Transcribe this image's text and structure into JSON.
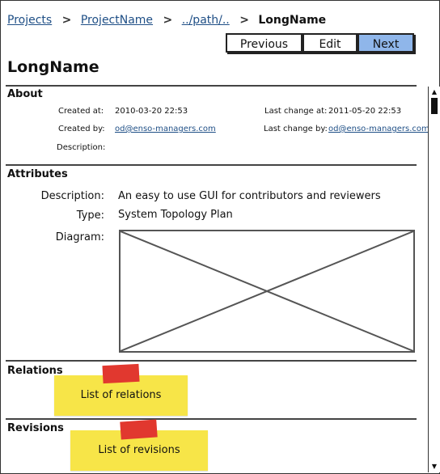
{
  "breadcrumb": {
    "items": [
      "Projects",
      "ProjectName",
      "../path/..",
      "LongName"
    ],
    "separator": ">"
  },
  "nav": {
    "previous_label": "Previous",
    "edit_label": "Edit",
    "next_label": "Next",
    "active_color": "#8fb6ea"
  },
  "page_title": "LongName",
  "about": {
    "title": "About",
    "created_at_label": "Created at:",
    "created_at_value": "2010-03-20 22:53",
    "last_change_at_label": "Last change at:",
    "last_change_at_value": "2011-05-20 22:53",
    "created_by_label": "Created by:",
    "created_by_value": "od@enso-managers.com",
    "last_change_by_label": "Last change by:",
    "last_change_by_value": "od@enso-managers.com",
    "description_label": "Description:"
  },
  "attributes": {
    "title": "Attributes",
    "description_label": "Description:",
    "description_value": "An easy to use GUI for contributors and reviewers",
    "type_label": "Type:",
    "type_value": "System Topology Plan",
    "diagram_label": "Diagram:"
  },
  "relations": {
    "title": "Relations",
    "note_text": "List of relations"
  },
  "revisions": {
    "title": "Revisions",
    "note_text": "List of revisions"
  },
  "colors": {
    "link": "#1f4f86",
    "note": "#f7e548",
    "tape": "#e1382f"
  },
  "icons": {
    "breadcrumb_separator": "chevron-right-icon",
    "scroll_up": "arrow-up-icon",
    "scroll_down": "arrow-down-icon"
  }
}
